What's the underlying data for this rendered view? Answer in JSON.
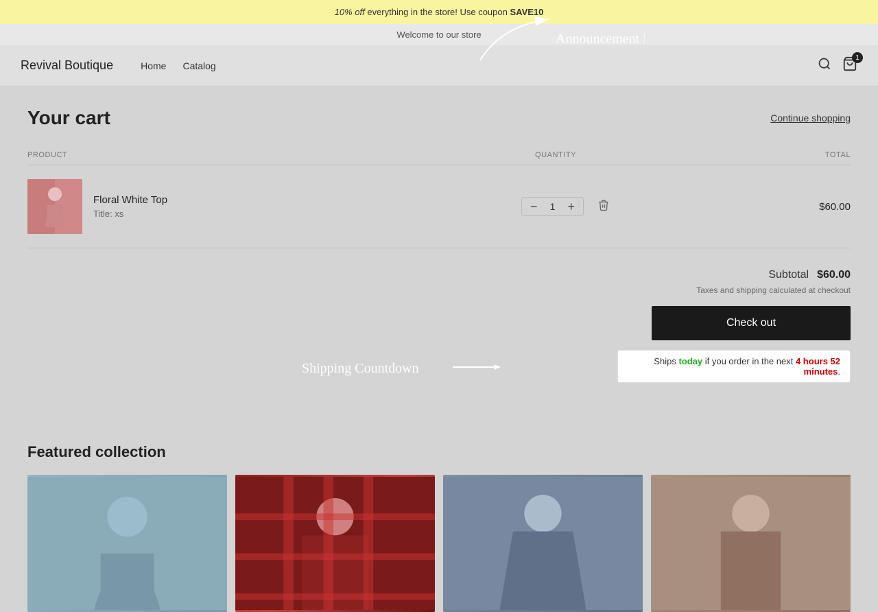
{
  "announcement": {
    "text_prefix": "10% off",
    "text_middle": "everything in the store! Use coupon ",
    "coupon_code": "SAVE10"
  },
  "welcome": {
    "text": "Welcome to our store"
  },
  "header": {
    "brand": "Revival Boutique",
    "nav": [
      {
        "label": "Home",
        "href": "#"
      },
      {
        "label": "Catalog",
        "href": "#"
      }
    ],
    "cart_count": "1"
  },
  "cart": {
    "title": "Your cart",
    "continue_shopping": "Continue shopping",
    "columns": {
      "product": "Product",
      "quantity": "Quantity",
      "total": "Total"
    },
    "items": [
      {
        "name": "Floral White Top",
        "variant_label": "Title: xs",
        "quantity": 1,
        "price": "$60.00"
      }
    ],
    "subtotal_label": "Subtotal",
    "subtotal_amount": "$60.00",
    "tax_note": "Taxes and shipping calculated at checkout",
    "checkout_btn": "Check out"
  },
  "shipping_countdown": {
    "prefix": "Ships ",
    "today_word": "today",
    "middle": " if you order in the next ",
    "time": "4 hours 52 minutes",
    "suffix": "."
  },
  "featured": {
    "title": "Featured collection"
  },
  "annotations": {
    "announcement_bar_label": "Announcement Bar",
    "shipping_label": "Shipping Countdown"
  }
}
